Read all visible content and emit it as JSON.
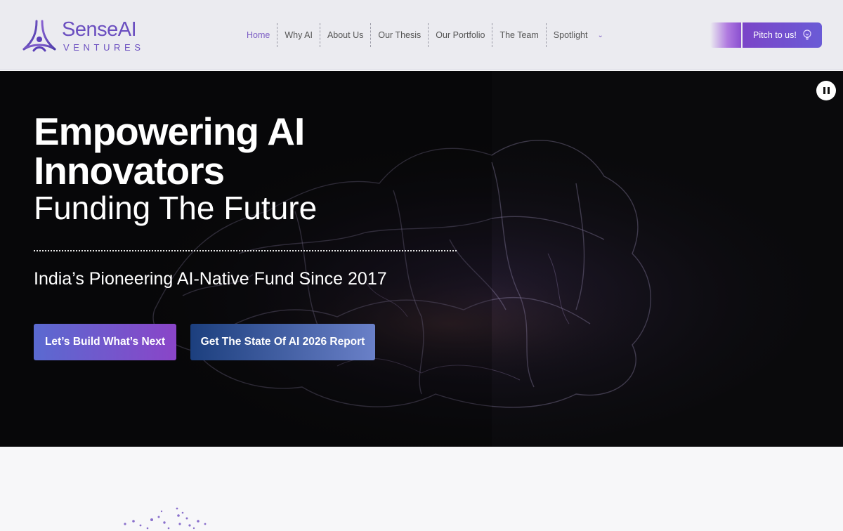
{
  "brand": {
    "name": "SenseAI",
    "subtitle": "VENTURES",
    "color": "#6b4fc0"
  },
  "nav": {
    "items": [
      {
        "label": "Home",
        "active": true
      },
      {
        "label": "Why AI"
      },
      {
        "label": "About Us"
      },
      {
        "label": "Our Thesis"
      },
      {
        "label": "Our Portfolio"
      },
      {
        "label": "The Team"
      },
      {
        "label": "Spotlight",
        "has_dropdown": true
      }
    ],
    "dropdown_icon": "chevron-down-icon"
  },
  "pitch": {
    "label": "Pitch to us!",
    "icon": "lightbulb-icon"
  },
  "hero": {
    "title": "Empowering AI Innovators",
    "subtitle": "Funding The Future",
    "tagline": "India’s Pioneering AI-Native Fund Since 2017",
    "cta_primary": "Let’s Build What’s Next",
    "cta_secondary": "Get The State Of AI 2026 Report",
    "pause_icon": "pause-icon"
  },
  "colors": {
    "accent": "#7b5cc4",
    "hero_bg": "#0c0c0f"
  }
}
